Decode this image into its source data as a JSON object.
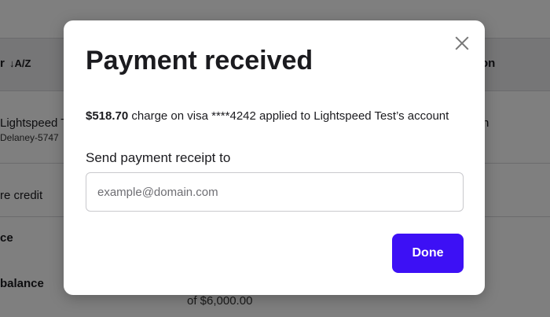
{
  "background": {
    "sort_header": "r",
    "sort_icon": "↓A/Z",
    "right_header": "on",
    "row1_name": "Lightspeed T",
    "row1_sub": "Delaney-5747",
    "row1_right": "n",
    "credit_label": "re credit",
    "ce_label": "ce",
    "balance_label": "balance",
    "of_amount": "of $6,000.00"
  },
  "modal": {
    "title": "Payment received",
    "summary_amount": "$518.70",
    "summary_rest": " charge on visa ****4242 applied to Lightspeed Test’s account",
    "receipt_label": "Send payment receipt to",
    "email_placeholder": "example@domain.com",
    "email_value": "",
    "done_label": "Done"
  },
  "colors": {
    "primary": "#3d10f5",
    "overlay": "rgba(0,0,0,0.5)"
  },
  "icons": {
    "close": "close-icon",
    "sort": "sort-alpha-icon"
  }
}
